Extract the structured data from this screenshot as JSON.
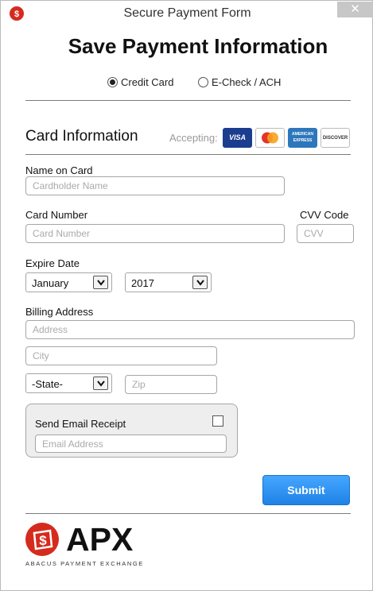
{
  "window": {
    "title": "Secure Payment Form",
    "close_glyph": "✕",
    "app_icon": "dollar-shield-icon"
  },
  "heading": "Save Payment Information",
  "payment_type": {
    "options": [
      {
        "label": "Credit Card",
        "selected": true
      },
      {
        "label": "E-Check / ACH",
        "selected": false
      }
    ]
  },
  "card_section": {
    "title": "Card Information",
    "accepting_label": "Accepting:",
    "cards": [
      {
        "name": "VISA",
        "icon": "visa-icon",
        "bg": "#1a3d8f",
        "fg": "#ffffff"
      },
      {
        "name": "MasterCard",
        "icon": "mastercard-icon",
        "bg": "#ffffff",
        "fg": "#e4352a"
      },
      {
        "name": "AMERICAN EXPRESS",
        "icon": "amex-icon",
        "bg": "#2e77bc",
        "fg": "#ffffff"
      },
      {
        "name": "DISCOVER",
        "icon": "discover-icon",
        "bg": "#ffffff",
        "fg": "#333333"
      }
    ]
  },
  "fields": {
    "name_label": "Name on Card",
    "name_placeholder": "Cardholder Name",
    "number_label": "Card Number",
    "number_placeholder": "Card Number",
    "cvv_label": "CVV Code",
    "cvv_placeholder": "CVV",
    "expire_label": "Expire Date",
    "month_value": "January",
    "year_value": "2017",
    "billing_label": "Billing Address",
    "address_placeholder": "Address",
    "city_placeholder": "City",
    "state_value": "-State-",
    "zip_placeholder": "Zip"
  },
  "email_receipt": {
    "label": "Send Email Receipt",
    "checked": false,
    "placeholder": "Email Address"
  },
  "submit_label": "Submit",
  "brand": {
    "logo_text": "APX",
    "tagline": "ABACUS PAYMENT EXCHANGE",
    "accent": "#d52b1e"
  },
  "colors": {
    "submit_blue": "#2b8ef0",
    "brand_red": "#d52b1e"
  }
}
